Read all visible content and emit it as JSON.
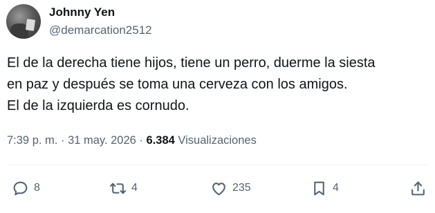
{
  "author": {
    "name": "Johnny Yen",
    "handle": "@demarcation2512",
    "avatar_icon": "avatar-photo"
  },
  "post": {
    "lines": [
      "El de la derecha tiene hijos, tiene un perro, duerme la siesta",
      "en paz y después se toma una cerveza con los amigos.",
      "El de la izquierda es cornudo."
    ]
  },
  "meta": {
    "time": "7:39 p. m.",
    "separator": "·",
    "date": "31 may. 2026",
    "views_count": "6.384",
    "views_label": "Visualizaciones"
  },
  "actions": {
    "reply": {
      "icon": "reply-icon",
      "count": "8"
    },
    "retweet": {
      "icon": "retweet-icon",
      "count": "4"
    },
    "like": {
      "icon": "heart-icon",
      "count": "235"
    },
    "bookmark": {
      "icon": "bookmark-icon",
      "count": "4"
    },
    "share": {
      "icon": "share-icon"
    }
  },
  "colors": {
    "text_primary": "#0f1419",
    "text_secondary": "#536471",
    "divider": "#eff3f4"
  }
}
